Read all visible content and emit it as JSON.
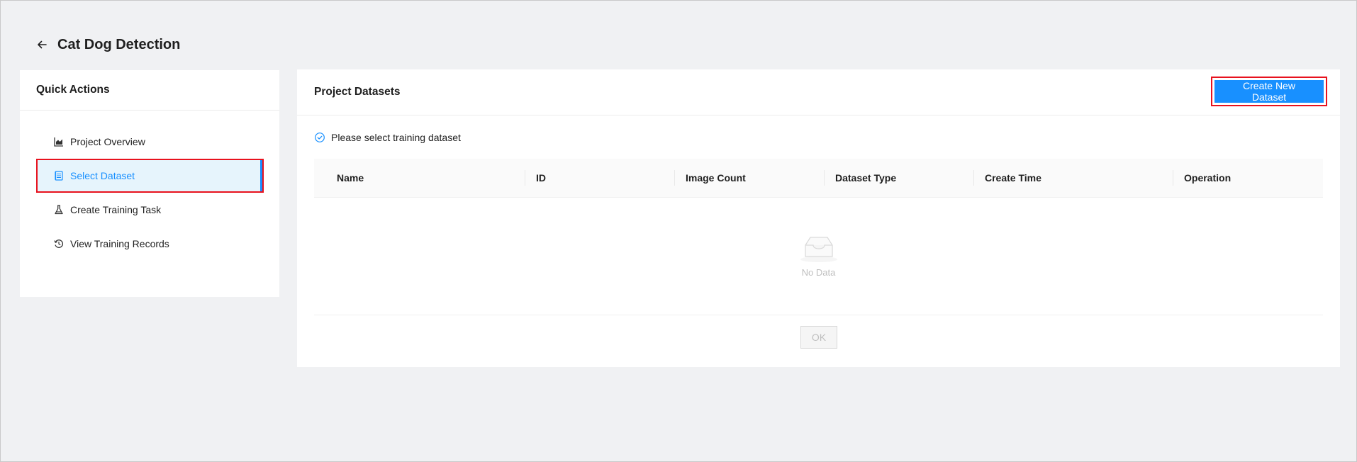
{
  "header": {
    "title": "Cat Dog Detection",
    "back_icon": "arrow-left-icon"
  },
  "quick_actions": {
    "title": "Quick Actions",
    "items": [
      {
        "label": "Project Overview",
        "icon": "area-chart-icon",
        "active": false
      },
      {
        "label": "Select Dataset",
        "icon": "database-icon",
        "active": true
      },
      {
        "label": "Create Training Task",
        "icon": "flask-icon",
        "active": false
      },
      {
        "label": "View Training Records",
        "icon": "history-icon",
        "active": false
      }
    ]
  },
  "datasets": {
    "title": "Project Datasets",
    "create_button": "Create New Dataset",
    "hint": "Please select training dataset",
    "columns": [
      "Name",
      "ID",
      "Image Count",
      "Dataset Type",
      "Create Time",
      "Operation"
    ],
    "rows": [],
    "empty_text": "No Data",
    "ok_button": "OK"
  },
  "colors": {
    "primary": "#1890ff",
    "highlight": "#e8121e",
    "background": "#f0f1f3"
  }
}
